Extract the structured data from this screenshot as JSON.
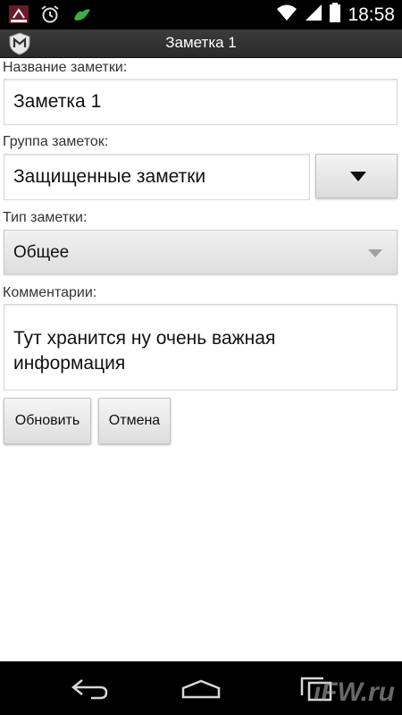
{
  "status_bar": {
    "time": "18:58",
    "icons": [
      "mcafee-notification-icon",
      "alarm-clock-icon",
      "android-icon",
      "wifi-icon",
      "signal-icon",
      "battery-icon"
    ]
  },
  "action_bar": {
    "title": "Заметка 1",
    "logo_icon": "mcafee-shield-icon"
  },
  "form": {
    "name_label": "Название заметки:",
    "name_value": "Заметка 1",
    "group_label": "Группа заметок:",
    "group_value": "Защищенные заметки",
    "type_label": "Тип заметки:",
    "type_value": "Общее",
    "comments_label": "Комментарии:",
    "comments_value": "Тут хранится ну очень важная информация"
  },
  "buttons": {
    "update": "Обновить",
    "cancel": "Отмена"
  },
  "nav_bar": {
    "icons": [
      "back-icon",
      "home-icon",
      "recent-apps-icon"
    ]
  },
  "watermark": "iFW.ru",
  "colors": {
    "status_bar_bg": "#000000",
    "action_bar_bg": "#333333",
    "page_bg": "#ffffff"
  }
}
